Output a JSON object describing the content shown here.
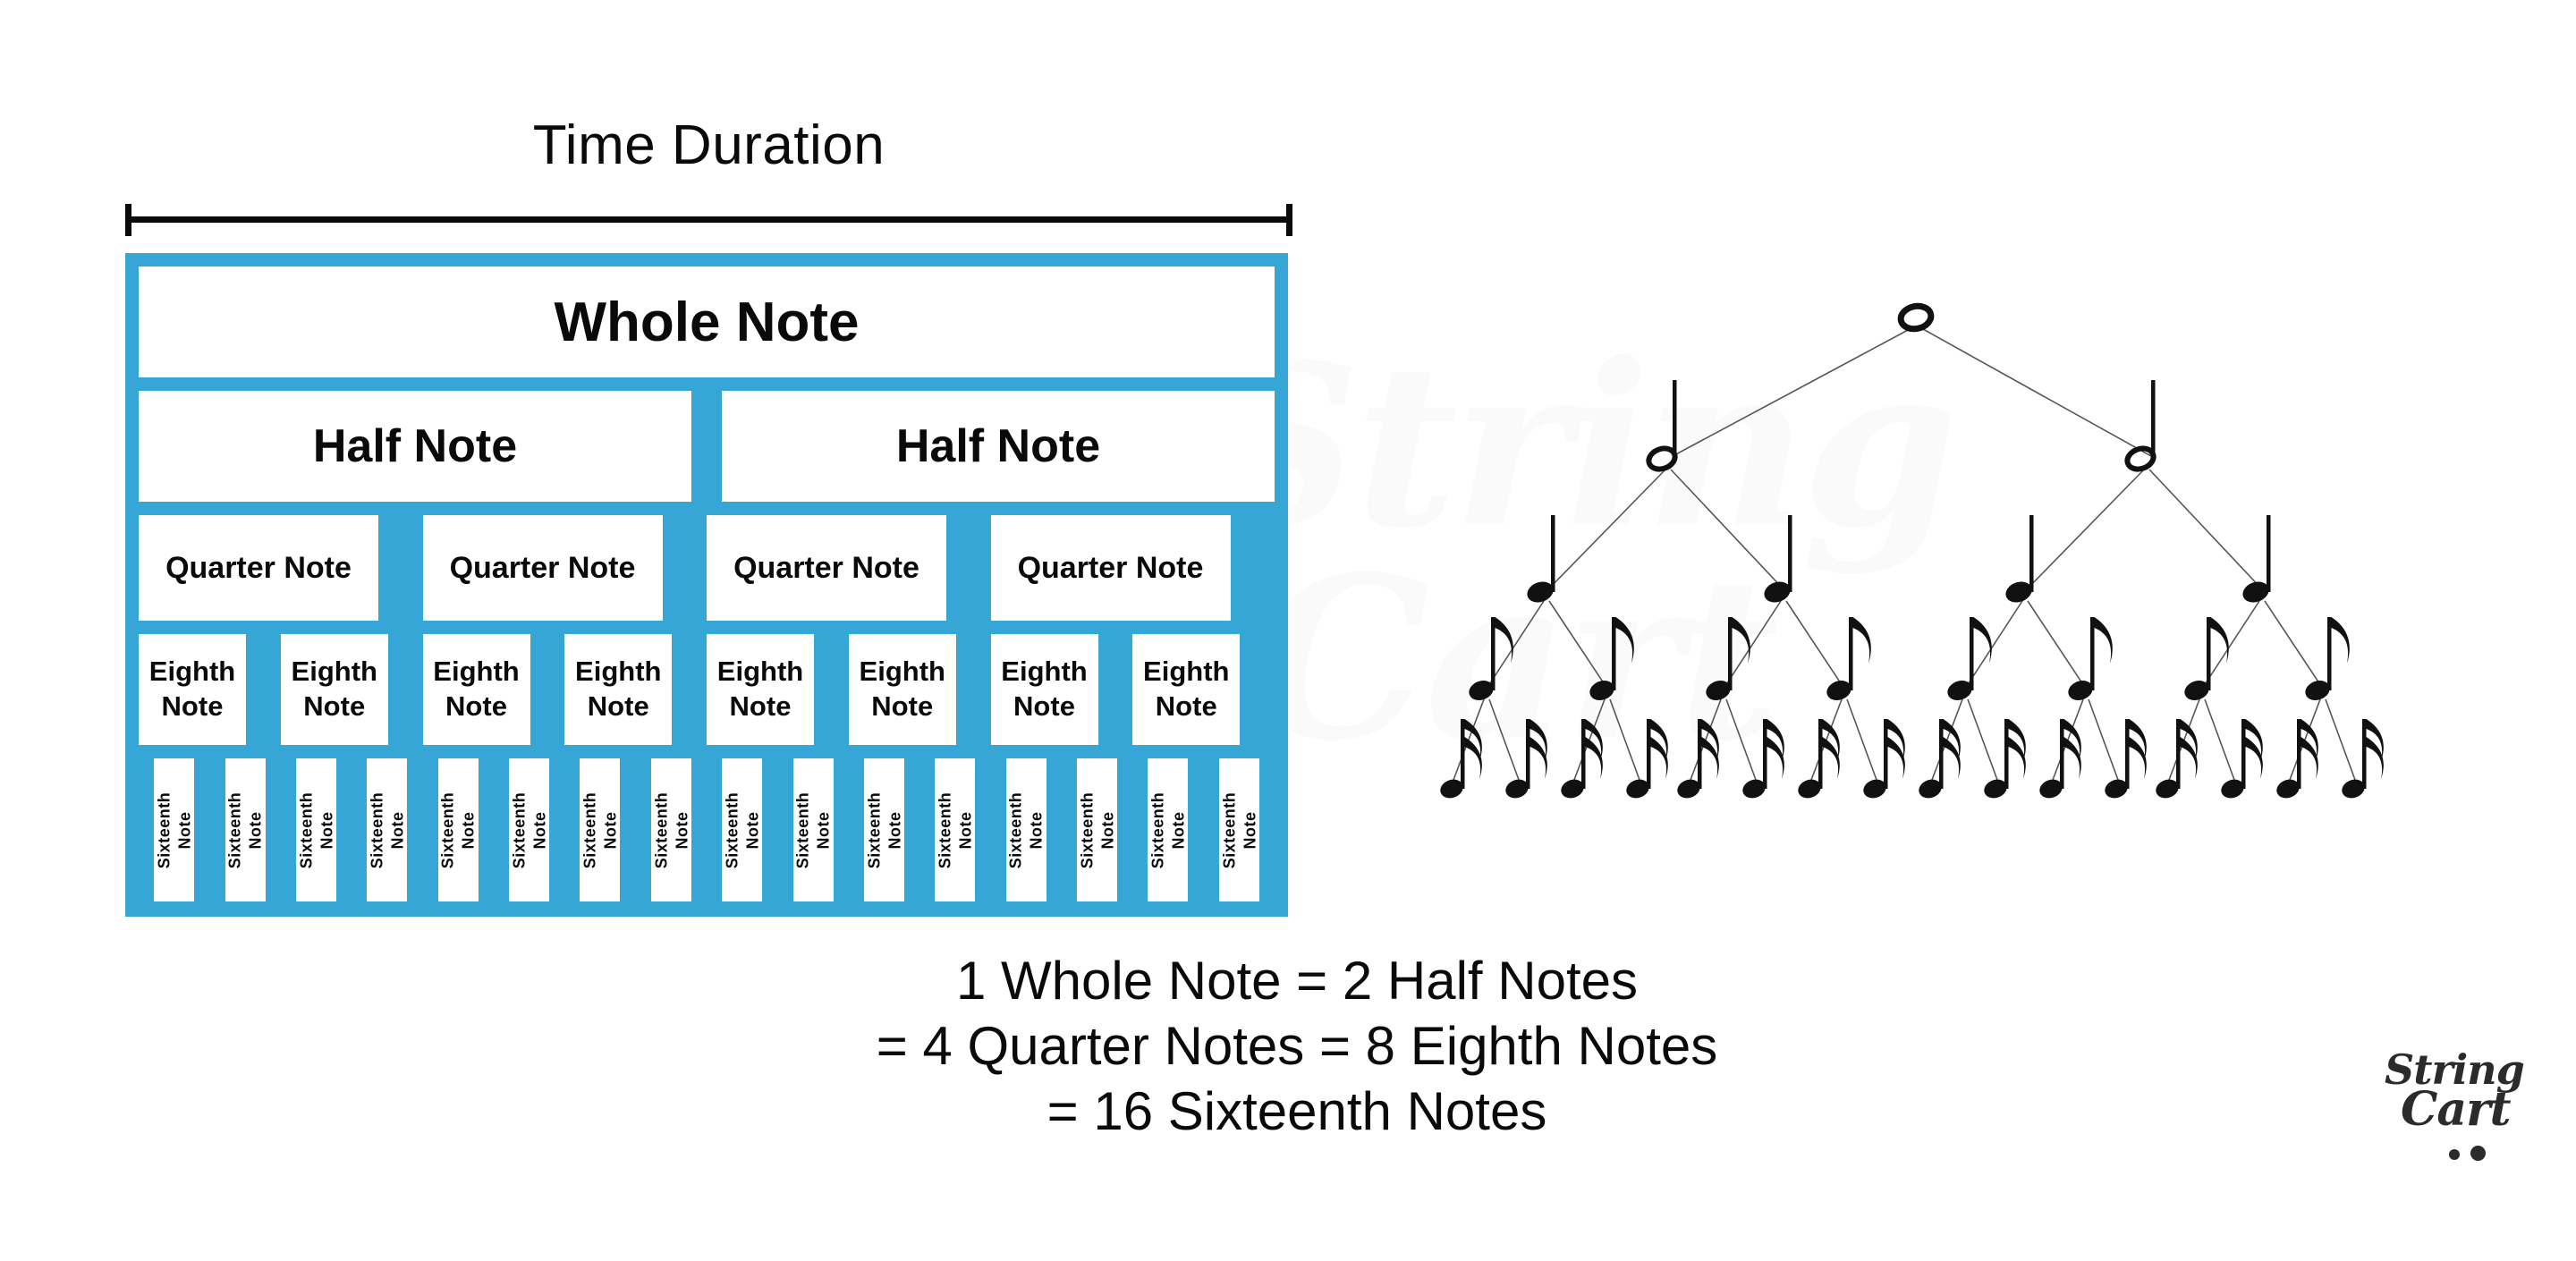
{
  "title": "Time Duration",
  "accent_color": "#35a6d6",
  "chart_data": {
    "type": "table",
    "title": "Time Duration",
    "description": "Note value subdivision chart: one whole note divided into halves, quarters, eighths and sixteenths over the same time duration.",
    "rows": [
      {
        "label": "Whole Note",
        "count": 1,
        "cells": [
          "Whole Note"
        ]
      },
      {
        "label": "Half Note",
        "count": 2,
        "cells": [
          "Half Note",
          "Half Note"
        ]
      },
      {
        "label": "Quarter Note",
        "count": 4,
        "cells": [
          "Quarter Note",
          "Quarter Note",
          "Quarter Note",
          "Quarter Note"
        ]
      },
      {
        "label": "Eighth Note",
        "count": 8,
        "cells": [
          "Eighth Note",
          "Eighth Note",
          "Eighth Note",
          "Eighth Note",
          "Eighth Note",
          "Eighth Note",
          "Eighth Note",
          "Eighth Note"
        ]
      },
      {
        "label": "Sixteenth Note",
        "count": 16,
        "cells": [
          "Sixteenth Note",
          "Sixteenth Note",
          "Sixteenth Note",
          "Sixteenth Note",
          "Sixteenth Note",
          "Sixteenth Note",
          "Sixteenth Note",
          "Sixteenth Note",
          "Sixteenth Note",
          "Sixteenth Note",
          "Sixteenth Note",
          "Sixteenth Note",
          "Sixteenth Note",
          "Sixteenth Note",
          "Sixteenth Note",
          "Sixteenth Note"
        ]
      }
    ]
  },
  "chart": {
    "whole": {
      "label": "Whole Note"
    },
    "half": {
      "label": "Half Note"
    },
    "quarter": {
      "label": "Quarter Note"
    },
    "eighth_l1": "Eighth",
    "eighth_l2": "Note",
    "sixteenth_l1": "Sixteenth",
    "sixteenth_l2": "Note"
  },
  "tree": {
    "levels": [
      {
        "name": "whole-note",
        "glyph": "whole",
        "count": 1
      },
      {
        "name": "half-note",
        "glyph": "half",
        "count": 2
      },
      {
        "name": "quarter-note",
        "glyph": "quarter",
        "count": 4
      },
      {
        "name": "eighth-note",
        "glyph": "eighth",
        "count": 8
      },
      {
        "name": "sixteenth-note",
        "glyph": "sixteenth",
        "count": 16
      }
    ]
  },
  "summary": {
    "line1": "1 Whole Note = 2 Half Notes",
    "line2": "= 4 Quarter Notes = 8 Eighth Notes",
    "line3": "= 16 Sixteenth Notes"
  },
  "brand": {
    "line1": "String",
    "line2": "Cart"
  },
  "watermark": {
    "line1": "String",
    "line2": "Cart"
  }
}
